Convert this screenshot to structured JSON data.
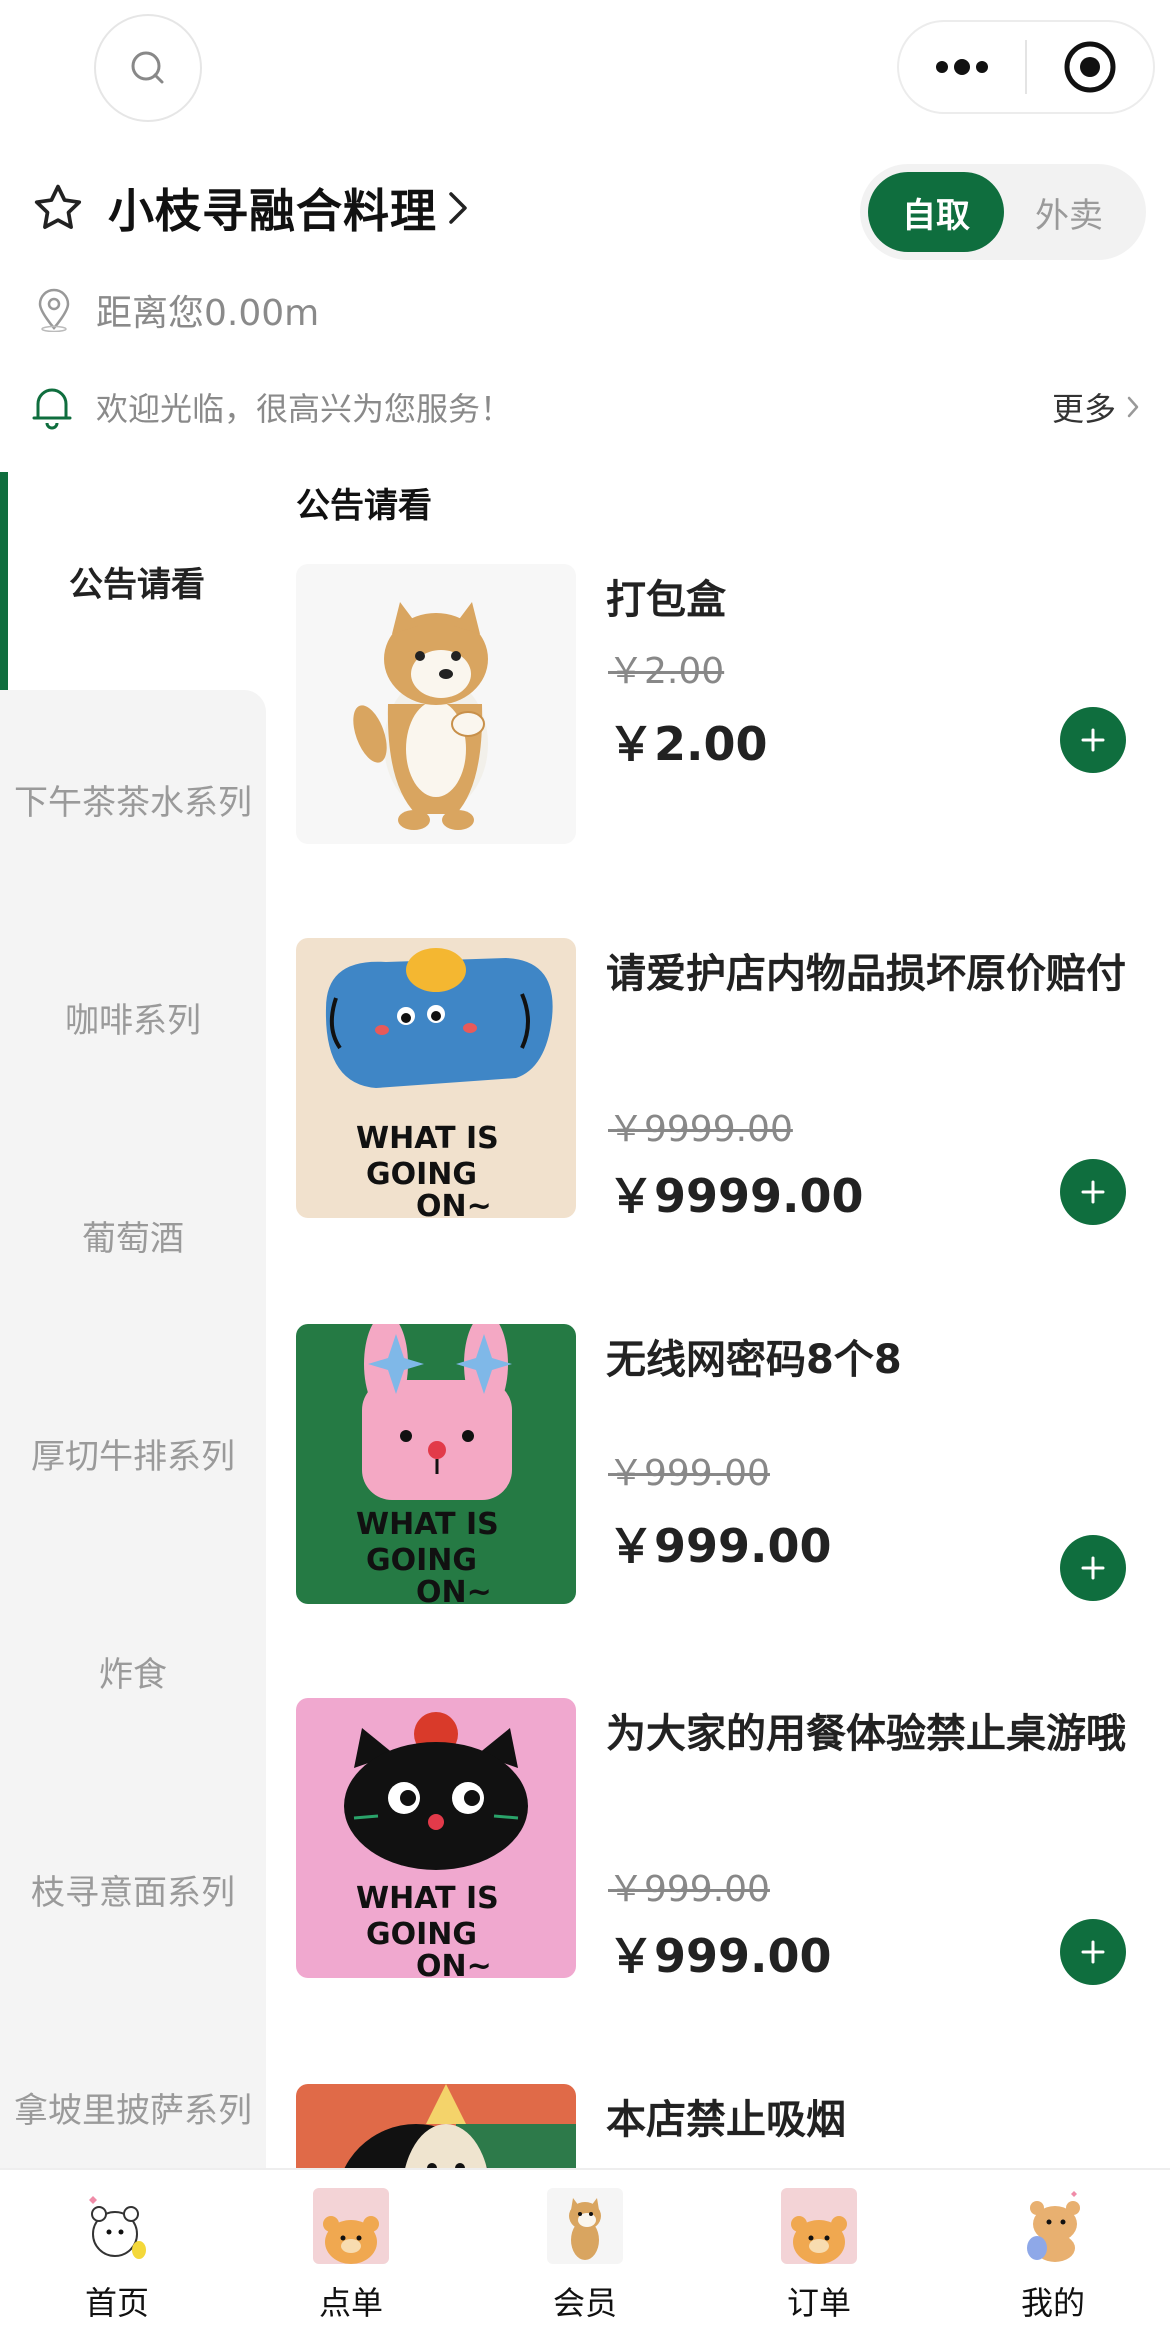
{
  "colors": {
    "brand": "#0f6e3e",
    "muted": "#9a9a9a",
    "sidebar_bg": "#f4f4f4"
  },
  "top_bar": {
    "search_icon": "search-icon",
    "capsule": {
      "menu_icon": "more-dots-icon",
      "close_icon": "target-circle-icon"
    }
  },
  "store": {
    "name": "小枝寻融合料理",
    "favorite_icon": "star-icon",
    "distance": "距离您0.00m",
    "notice": "欢迎光临，很高兴为您服务！",
    "more_label": "更多",
    "modes": {
      "pickup": "自取",
      "delivery": "外卖",
      "selected": "自取"
    }
  },
  "sidebar": {
    "items": [
      {
        "label": "公告请看",
        "active": true
      },
      {
        "label": "下午茶茶水系列"
      },
      {
        "label": "咖啡系列"
      },
      {
        "label": "葡萄酒"
      },
      {
        "label": "厚切牛排系列"
      },
      {
        "label": "炸食"
      },
      {
        "label": "枝寻意面系列"
      },
      {
        "label": "拿坡里披萨系列"
      }
    ]
  },
  "menu": {
    "section_title": "公告请看",
    "products": [
      {
        "name": "打包盒",
        "original_price": "￥2.00",
        "price": "￥2.00",
        "image": "shiba-dog-sticker"
      },
      {
        "name": "请爱护店内物品损坏原价赔付",
        "original_price": "￥9999.00",
        "price": "￥9999.00",
        "image": "blue-elephant-what-is-going-on"
      },
      {
        "name": "无线网密码8个8",
        "original_price": "￥999.00",
        "price": "￥999.00",
        "image": "pink-bunny-what-is-going-on"
      },
      {
        "name": "为大家的用餐体验禁止桌游哦",
        "original_price": "￥999.00",
        "price": "￥999.00",
        "image": "black-cat-what-is-going-on"
      },
      {
        "name": "本店禁止吸烟",
        "image": "party-hat-sticker"
      }
    ]
  },
  "tabbar": {
    "items": [
      {
        "label": "首页",
        "icon": "bear-home-icon"
      },
      {
        "label": "点单",
        "icon": "bear-order-icon"
      },
      {
        "label": "会员",
        "icon": "dog-member-icon"
      },
      {
        "label": "订单",
        "icon": "bear-orders-icon"
      },
      {
        "label": "我的",
        "icon": "bear-profile-icon"
      }
    ]
  }
}
